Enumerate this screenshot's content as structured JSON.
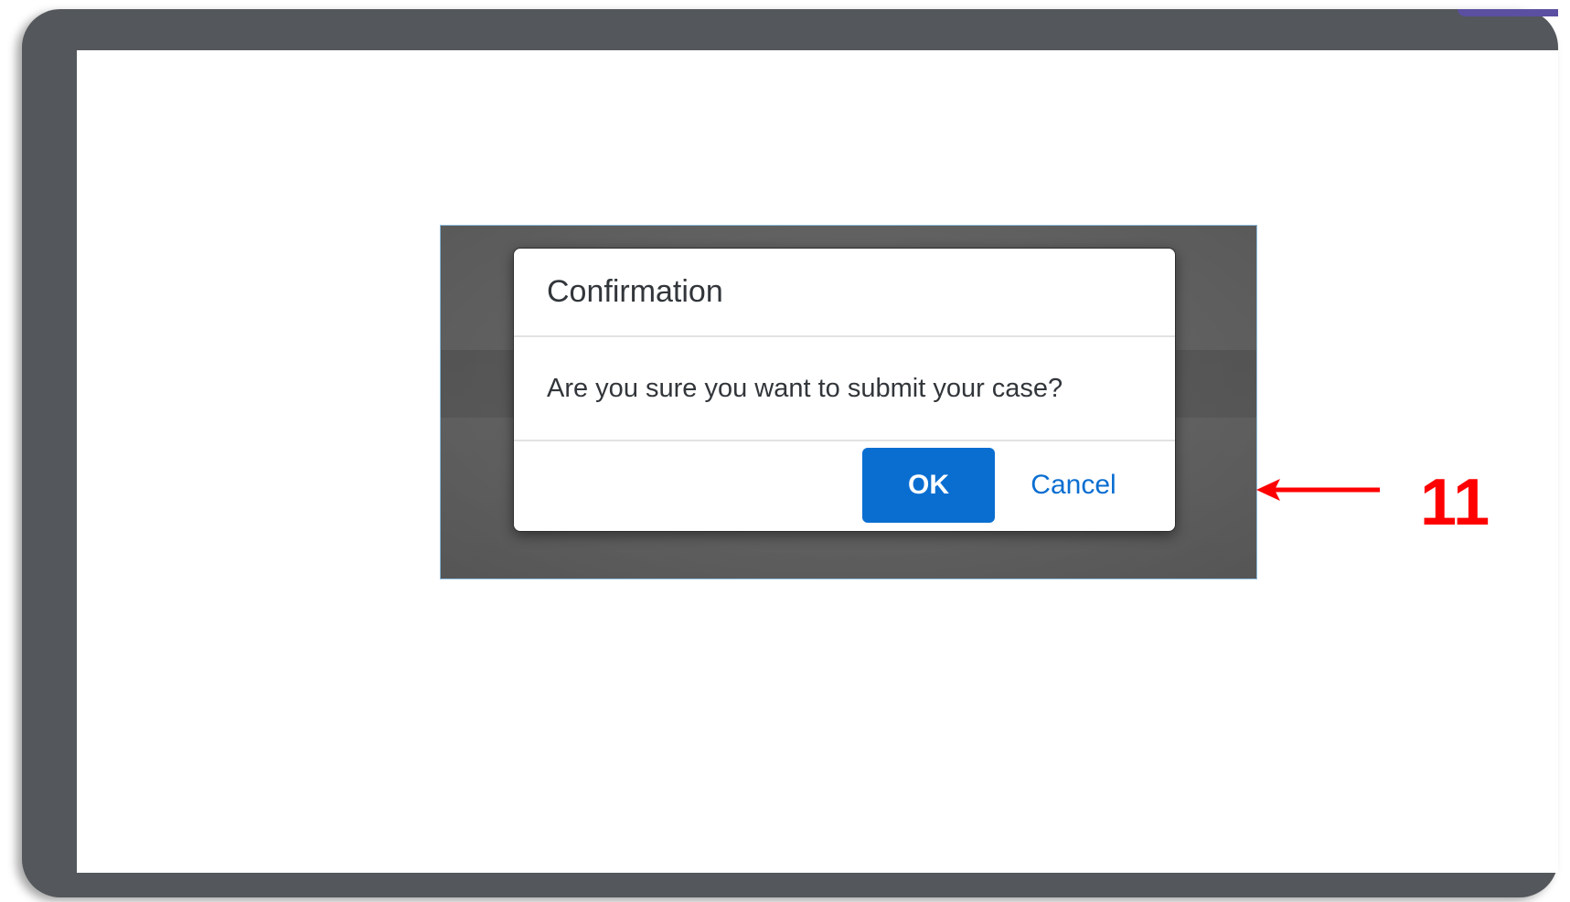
{
  "dialog": {
    "title": "Confirmation",
    "message": "Are you sure you want to submit your case?",
    "ok_label": "OK",
    "cancel_label": "Cancel"
  },
  "annotation": {
    "step_number": "11",
    "arrow_icon": "left-arrow-icon"
  },
  "colors": {
    "primary_button": "#0a6ed1",
    "annotation": "#ff0000",
    "frame": "#54575b",
    "overlay": "#646464"
  }
}
